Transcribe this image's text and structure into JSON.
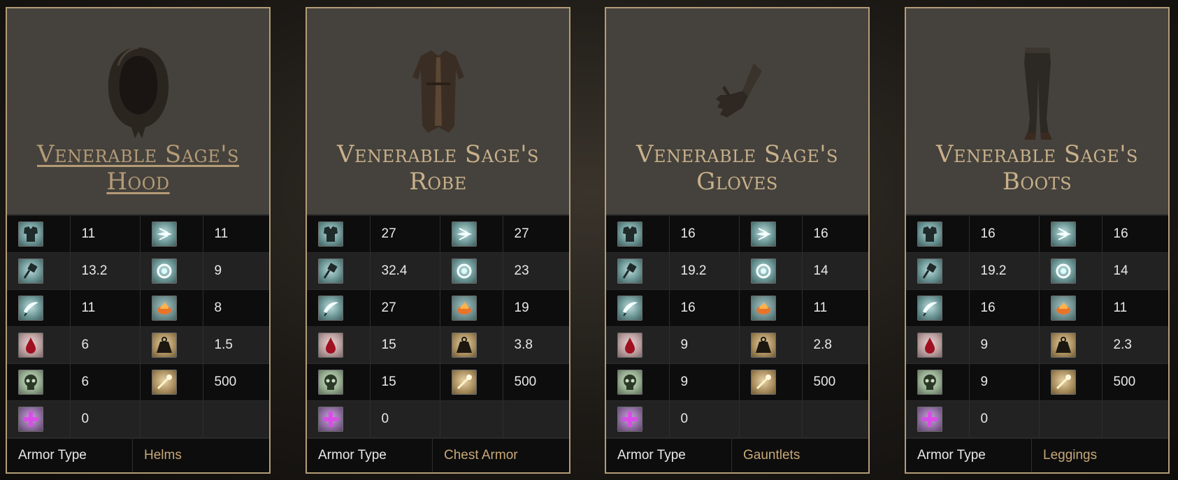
{
  "cards": [
    {
      "name_line1": "Venerable Sage's",
      "name_line2": "Hood",
      "armor_type_label": "Armor Type",
      "armor_type": "Helms",
      "stats": [
        {
          "a": "11",
          "b": "11"
        },
        {
          "a": "13.2",
          "b": "9"
        },
        {
          "a": "11",
          "b": "8"
        },
        {
          "a": "6",
          "b": "1.5"
        },
        {
          "a": "6",
          "b": "500"
        },
        {
          "a": "0"
        }
      ]
    },
    {
      "name_line1": "Venerable Sage's",
      "name_line2": "Robe",
      "armor_type_label": "Armor Type",
      "armor_type": "Chest Armor",
      "stats": [
        {
          "a": "27",
          "b": "27"
        },
        {
          "a": "32.4",
          "b": "23"
        },
        {
          "a": "27",
          "b": "19"
        },
        {
          "a": "15",
          "b": "3.8"
        },
        {
          "a": "15",
          "b": "500"
        },
        {
          "a": "0"
        }
      ]
    },
    {
      "name_line1": "Venerable Sage's",
      "name_line2": "Gloves",
      "armor_type_label": "Armor Type",
      "armor_type": "Gauntlets",
      "stats": [
        {
          "a": "16",
          "b": "16"
        },
        {
          "a": "19.2",
          "b": "14"
        },
        {
          "a": "16",
          "b": "11"
        },
        {
          "a": "9",
          "b": "2.8"
        },
        {
          "a": "9",
          "b": "500"
        },
        {
          "a": "0"
        }
      ]
    },
    {
      "name_line1": "Venerable Sage's",
      "name_line2": "Boots",
      "armor_type_label": "Armor Type",
      "armor_type": "Leggings",
      "stats": [
        {
          "a": "16",
          "b": "16"
        },
        {
          "a": "19.2",
          "b": "14"
        },
        {
          "a": "16",
          "b": "11"
        },
        {
          "a": "9",
          "b": "2.3"
        },
        {
          "a": "9",
          "b": "500"
        },
        {
          "a": "0"
        }
      ]
    }
  ],
  "icons": {
    "row0": [
      "chestplate-icon",
      "magic-bolt-icon"
    ],
    "row1": [
      "hammer-icon",
      "frost-ring-icon"
    ],
    "row2": [
      "blade-icon",
      "fire-icon"
    ],
    "row3": [
      "blood-drop-icon",
      "weight-icon"
    ],
    "row4": [
      "skull-icon",
      "durability-icon"
    ],
    "row5": [
      "cross-ward-icon"
    ]
  },
  "colors": {
    "border": "#b49d77",
    "title": "#c8b08a",
    "armor_type_value": "#c8a878"
  }
}
